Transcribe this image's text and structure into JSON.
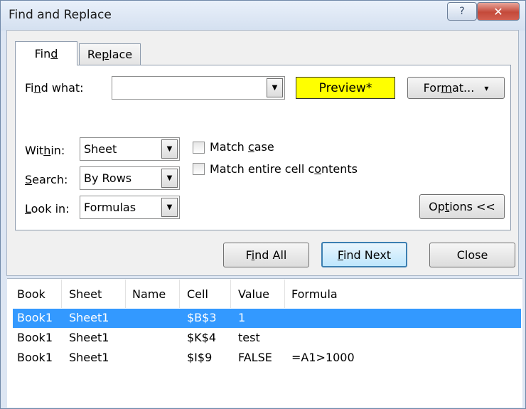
{
  "window": {
    "title": "Find and Replace",
    "help_glyph": "?",
    "close_glyph": "✕"
  },
  "tabs": [
    {
      "pre": "Fin",
      "ul": "d",
      "post": ""
    },
    {
      "pre": "Re",
      "ul": "p",
      "post": "lace"
    }
  ],
  "find_what": {
    "pre": "Fi",
    "ul": "n",
    "post": "d what:",
    "value": ""
  },
  "preview": "Preview*",
  "format_button": {
    "pre": "For",
    "ul": "m",
    "post": "at...",
    "arrow": "▾"
  },
  "within": {
    "pre": "Wit",
    "ul": "h",
    "post": "in:",
    "value": "Sheet"
  },
  "search": {
    "pre": "",
    "ul": "S",
    "post": "earch:",
    "value": "By Rows"
  },
  "look_in": {
    "pre": "",
    "ul": "L",
    "post": "ook in:",
    "value": "Formulas"
  },
  "match_case": {
    "pre": "Match ",
    "ul": "c",
    "post": "ase",
    "checked": false
  },
  "match_entire": {
    "pre": "Match entire cell c",
    "ul": "o",
    "post": "ntents",
    "checked": false
  },
  "options_button": {
    "pre": "Op",
    "ul": "t",
    "post": "ions <<"
  },
  "find_all_button": {
    "pre": "F",
    "ul": "i",
    "post": "nd All"
  },
  "find_next_button": {
    "pre": "",
    "ul": "F",
    "post": "ind Next"
  },
  "close_button": {
    "label": "Close"
  },
  "dropdown_arrow": "▼",
  "results": {
    "headers": [
      "Book",
      "Sheet",
      "Name",
      "Cell",
      "Value",
      "Formula"
    ],
    "rows": [
      [
        "Book1",
        "Sheet1",
        "",
        "$B$3",
        "1",
        ""
      ],
      [
        "Book1",
        "Sheet1",
        "",
        "$K$4",
        "test",
        ""
      ],
      [
        "Book1",
        "Sheet1",
        "",
        "$I$9",
        "FALSE",
        "=A1>1000"
      ]
    ],
    "selected_row": 0
  },
  "colors": {
    "selection": "#3399ff",
    "preview_bg": "#ffff00"
  }
}
